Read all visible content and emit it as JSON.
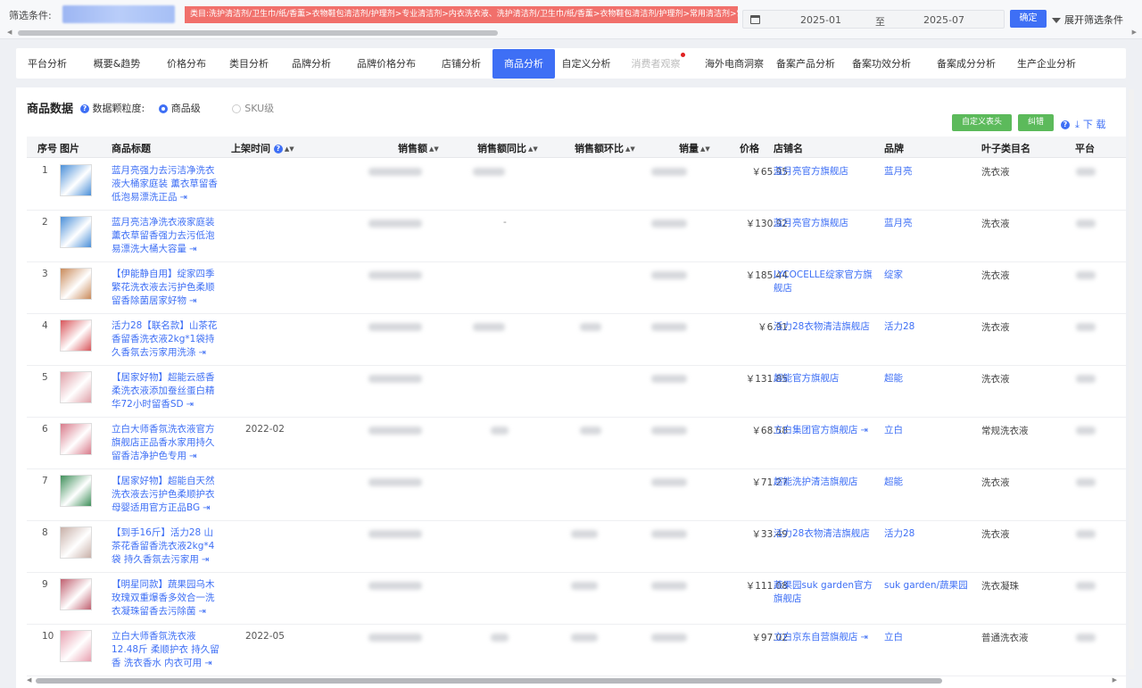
{
  "filter": {
    "label": "筛选条件:",
    "tag": "类目:洗护清洁剂/卫生巾/纸/香薰>衣物鞋包清洁剂/护理剂>专业清洁剂>内衣洗衣液、洗护清洁剂/卫生巾/纸/香薰>衣物鞋包清洁剂/护理剂>常用清洁剂>常规洗衣",
    "date_start": "2025-01",
    "date_to": "至",
    "date_end": "2025-07",
    "confirm_label": "确定",
    "expand_label": "展开筛选条件"
  },
  "tabs": [
    {
      "label": "平台分析",
      "state": "normal"
    },
    {
      "label": "概要&趋势",
      "state": "normal"
    },
    {
      "label": "价格分布",
      "state": "normal"
    },
    {
      "label": "类目分析",
      "state": "normal"
    },
    {
      "label": "品牌分析",
      "state": "normal"
    },
    {
      "label": "品牌价格分布",
      "state": "normal"
    },
    {
      "label": "店铺分析",
      "state": "normal"
    },
    {
      "label": "商品分析",
      "state": "active"
    },
    {
      "label": "自定义分析",
      "state": "normal"
    },
    {
      "label": "消费者观察",
      "state": "disabled"
    },
    {
      "label": "海外电商洞察",
      "state": "normal"
    },
    {
      "label": "备案产品分析",
      "state": "normal"
    },
    {
      "label": "备案功效分析",
      "state": "normal"
    },
    {
      "label": "备案成分分析",
      "state": "normal"
    },
    {
      "label": "生产企业分析",
      "state": "normal"
    }
  ],
  "panel": {
    "title": "商品数据",
    "granularity_label": "数据颗粒度:",
    "option_product": "商品级",
    "option_sku": "SKU级",
    "custom_header_label": "自定义表头",
    "error_label": "纠错",
    "download_label": "下 载"
  },
  "columns": {
    "no": "序号",
    "img": "图片",
    "title": "商品标题",
    "listed": "上架时间",
    "sales": "销售额",
    "yoy": "销售额同比",
    "mom": "销售额环比",
    "volume": "销量",
    "price": "价格",
    "shop": "店铺名",
    "brand": "品牌",
    "category": "叶子类目名",
    "platform": "平台"
  },
  "rows": [
    {
      "no": "1",
      "title": "蓝月亮强力去污洁净洗衣液大桶家庭装 薰衣草留香低泡易漂洗正品",
      "listed": "",
      "yoy_text": "",
      "price": "￥65.95",
      "shop": "蓝月亮官方旗舰店",
      "shop_link": false,
      "brand": "蓝月亮",
      "category": "洗衣液"
    },
    {
      "no": "2",
      "title": "蓝月亮洁净洗衣液家庭装 薰衣草留香强力去污低泡易漂洗大桶大容量",
      "listed": "",
      "yoy_text": "-",
      "price": "￥130.92",
      "shop": "蓝月亮官方旗舰店",
      "shop_link": false,
      "brand": "蓝月亮",
      "category": "洗衣液"
    },
    {
      "no": "3",
      "title": "【伊能静自用】绽家四季繁花洗衣液去污护色柔顺留香除菌居家好物",
      "listed": "",
      "yoy_text": "",
      "price": "￥185.44",
      "shop": "LYCOCELLE绽家官方旗舰店",
      "shop_link": false,
      "brand": "绽家",
      "category": "洗衣液"
    },
    {
      "no": "4",
      "title": "活力28【联名款】山茶花香留香洗衣液2kg*1袋持久香氛去污家用洗涤",
      "listed": "",
      "yoy_text": "",
      "price": "￥6.91",
      "shop": "活力28衣物清洁旗舰店",
      "shop_link": false,
      "brand": "活力28",
      "category": "洗衣液"
    },
    {
      "no": "5",
      "title": "【居家好物】超能云感香柔洗衣液添加蚕丝蛋白精华72小时留香SD",
      "listed": "",
      "yoy_text": "",
      "price": "￥131.85",
      "shop": "超能官方旗舰店",
      "shop_link": false,
      "brand": "超能",
      "category": "洗衣液"
    },
    {
      "no": "6",
      "title": "立白大师香氛洗衣液官方旗舰店正品香水家用持久留香洁净护色专用",
      "listed": "2022-02",
      "yoy_text": "",
      "price": "￥68.58",
      "shop": "立白集团官方旗舰店",
      "shop_link": true,
      "brand": "立白",
      "category": "常规洗衣液"
    },
    {
      "no": "7",
      "title": "【居家好物】超能自天然洗衣液去污护色柔顺护衣母婴适用官方正品BG",
      "listed": "",
      "yoy_text": "",
      "price": "￥71.27",
      "shop": "超能洗护清洁旗舰店",
      "shop_link": false,
      "brand": "超能",
      "category": "洗衣液"
    },
    {
      "no": "8",
      "title": "【到手16斤】活力28 山茶花香留香洗衣液2kg*4袋 持久香氛去污家用",
      "listed": "",
      "yoy_text": "",
      "price": "￥33.49",
      "shop": "活力28衣物清洁旗舰店",
      "shop_link": false,
      "brand": "活力28",
      "category": "洗衣液"
    },
    {
      "no": "9",
      "title": "【明星同款】蔬果园乌木玫瑰双重爆香多效合一洗衣凝珠留香去污除菌",
      "listed": "",
      "yoy_text": "",
      "price": "￥111.08",
      "shop": "蔬果园suk garden官方旗舰店",
      "shop_link": false,
      "brand": "suk garden/蔬果园",
      "category": "洗衣凝珠"
    },
    {
      "no": "10",
      "title": "立白大师香氛洗衣液 12.48斤 柔顺护衣 持久留香 洗衣香水 内衣可用",
      "listed": "2022-05",
      "yoy_text": "",
      "price": "￥97.02",
      "shop": "立白京东自营旗舰店",
      "shop_link": true,
      "brand": "立白",
      "category": "普通洗衣液"
    }
  ],
  "thumb_colors": [
    "#4a8fd8",
    "#4a8fd8",
    "#c98a5a",
    "#d8555a",
    "#e0a0a8",
    "#d87a8a",
    "#3f8f5a",
    "#c8b0a8",
    "#c06070",
    "#e8a0b0"
  ]
}
